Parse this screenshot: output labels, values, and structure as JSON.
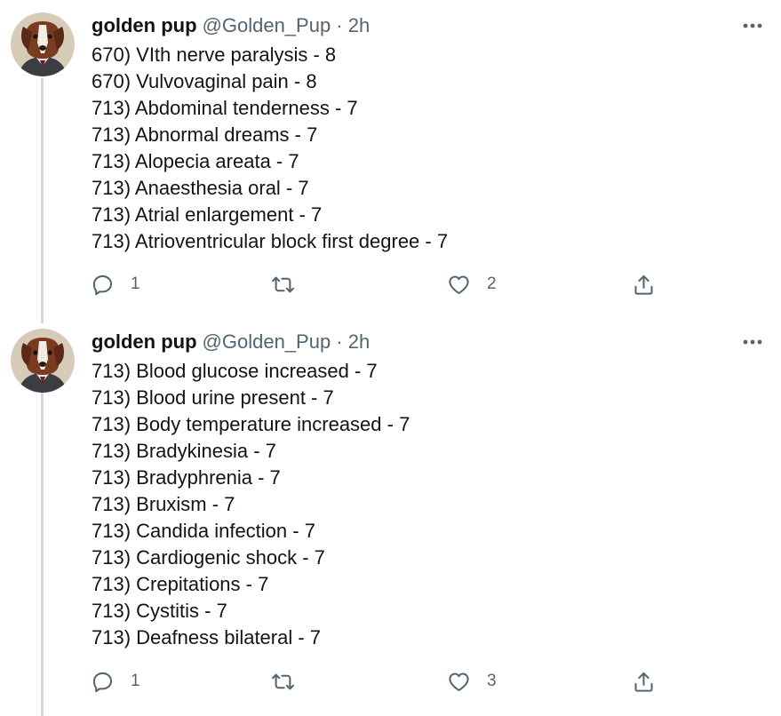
{
  "theme": {
    "text_color": "#0f1419",
    "secondary_color": "#536471",
    "thread_line_color": "#cfd9de"
  },
  "tweets": [
    {
      "author": {
        "display_name": "golden pup",
        "handle_meta": "@Golden_Pup · 2h",
        "avatar": "dog-portrait-avatar"
      },
      "lines": [
        "670) VIth nerve paralysis - 8",
        "670) Vulvovaginal pain - 8",
        "713) Abdominal tenderness - 7",
        "713) Abnormal dreams - 7",
        "713) Alopecia areata - 7",
        "713) Anaesthesia oral - 7",
        "713) Atrial enlargement - 7",
        "713) Atrioventricular block first degree - 7"
      ],
      "actions": {
        "reply_count": "1",
        "retweet_count": "",
        "like_count": "2"
      }
    },
    {
      "author": {
        "display_name": "golden pup",
        "handle_meta": "@Golden_Pup · 2h",
        "avatar": "dog-portrait-avatar"
      },
      "lines": [
        "713) Blood glucose increased - 7",
        "713) Blood urine present - 7",
        "713) Body temperature increased - 7",
        "713) Bradykinesia - 7",
        "713) Bradyphrenia - 7",
        "713) Bruxism - 7",
        "713) Candida infection - 7",
        "713) Cardiogenic shock - 7",
        "713) Crepitations - 7",
        "713) Cystitis - 7",
        "713) Deafness bilateral - 7"
      ],
      "actions": {
        "reply_count": "1",
        "retweet_count": "",
        "like_count": "3"
      }
    }
  ],
  "icons": {
    "reply": "reply-icon",
    "retweet": "retweet-icon",
    "like": "heart-icon",
    "share": "share-icon",
    "more": "more-options-icon"
  }
}
